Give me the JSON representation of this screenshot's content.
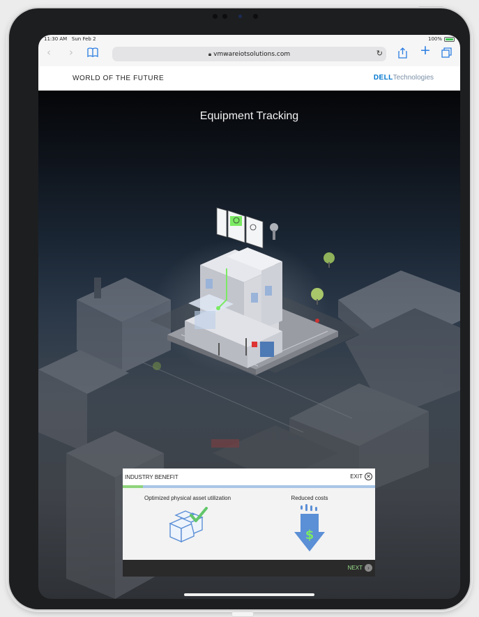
{
  "status_bar": {
    "time": "11:30 AM",
    "date": "Sun Feb 2",
    "battery": "100%"
  },
  "browser": {
    "url": "vmwareiotsolutions.com"
  },
  "site": {
    "title": "WORLD OF THE FUTURE",
    "brand_bold": "DELL",
    "brand_light": "Technologies"
  },
  "hero": {
    "title": "Equipment Tracking"
  },
  "panel": {
    "label": "INDUSTRY BENEFIT",
    "exit_label": "EXIT",
    "progress": 0.08,
    "benefits": [
      {
        "label": "Optimized physical asset utilization",
        "icon": "boxes-check-icon"
      },
      {
        "label": "Reduced costs",
        "icon": "dollar-down-arrow-icon"
      }
    ],
    "next_label": "NEXT"
  },
  "colors": {
    "accent_green": "#8fd47c",
    "progress_track": "#a9c6e6",
    "icon_blue": "#5b8fd6",
    "brand_blue": "#0076ce"
  }
}
